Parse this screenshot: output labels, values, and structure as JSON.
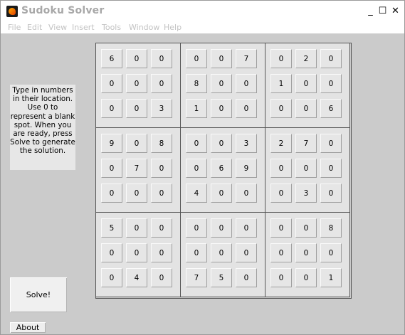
{
  "window": {
    "title": "Sudoku Solver",
    "minimize": "_",
    "maximize": "☐",
    "close": "✕"
  },
  "menu": [
    "File",
    "Edit",
    "View",
    "Insert",
    "Tools",
    "Window",
    "Help"
  ],
  "instructions": "Type in numbers in their location. Use 0 to represent a blank spot. When you are ready, press Solve to generate the solution.",
  "buttons": {
    "solve": "Solve!",
    "about": "About"
  },
  "grid": [
    [
      6,
      0,
      0,
      0,
      0,
      7,
      0,
      2,
      0
    ],
    [
      0,
      0,
      0,
      8,
      0,
      0,
      1,
      0,
      0
    ],
    [
      0,
      0,
      3,
      1,
      0,
      0,
      0,
      0,
      6
    ],
    [
      9,
      0,
      8,
      0,
      0,
      3,
      2,
      7,
      0
    ],
    [
      0,
      7,
      0,
      0,
      6,
      9,
      0,
      0,
      0
    ],
    [
      0,
      0,
      0,
      4,
      0,
      0,
      0,
      3,
      0
    ],
    [
      5,
      0,
      0,
      0,
      0,
      0,
      0,
      0,
      8
    ],
    [
      0,
      0,
      0,
      0,
      0,
      0,
      0,
      0,
      0
    ],
    [
      0,
      4,
      0,
      7,
      5,
      0,
      0,
      0,
      1
    ]
  ],
  "colors": {
    "window_bg": "#cbcbcb",
    "menu_text_disabled": "#c3c3c3",
    "title_text": "#a8a8a8"
  }
}
